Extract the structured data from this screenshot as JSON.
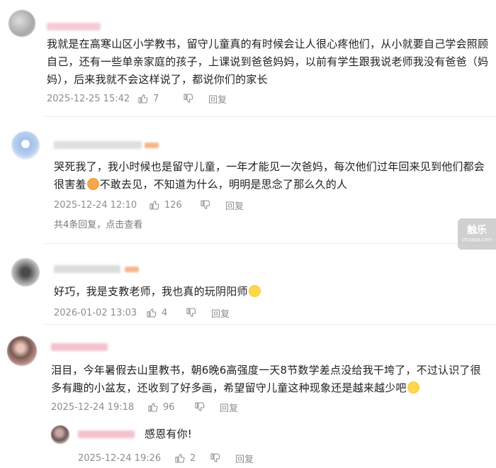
{
  "comments": [
    {
      "text": "我就是在高寒山区小学教书，留守儿童真的有时候会让人很心疼他们，从小就要自己学会照顾自己，还有一些单亲家庭的孩子，上课说到爸爸妈妈，以前有学生跟我说老师我没有爸爸（妈妈），后来我就不会这样说了，都说你们的家长",
      "time": "2025-12-25 15:42",
      "likes": "7",
      "reply_label": "回复"
    },
    {
      "text_before_emoji": "哭死我了，我小时候也是留守儿童，一年才能见一次爸妈，每次他们过年回来见到他们都会很害羞",
      "text_after_emoji": "不敢去见，不知道为什么，明明是思念了那么久的人",
      "time": "2025-12-24 12:10",
      "likes": "126",
      "reply_label": "回复",
      "more_replies": "共4条回复，点击查看"
    },
    {
      "text": "好巧，我是支教老师，我也真的玩阴阳师",
      "time": "2026-01-02 13:03",
      "likes": "4",
      "reply_label": "回复"
    },
    {
      "text": "泪目，今年暑假去山里教书，朝6晚6高强度一天8节数学差点没给我干垮了，不过认识了很多有趣的小盆友，还收到了好多画，希望留守儿童这种现象还是越来越少吧",
      "time": "2025-12-24 19:18",
      "likes": "96",
      "reply_label": "回复",
      "sub_reply": {
        "text": "感恩有你!",
        "time": "2025-12-24 19:26",
        "likes": "2",
        "reply_label": "回复"
      }
    }
  ],
  "watermark": {
    "main": "触乐",
    "sub": "chuapp.com"
  },
  "icons": {
    "like": "thumbs-up-icon",
    "dislike": "thumbs-down-icon"
  },
  "colors": {
    "meta_text": "#8e8e8e",
    "username_blur": "#f2b8c6",
    "divider": "#ececec"
  }
}
